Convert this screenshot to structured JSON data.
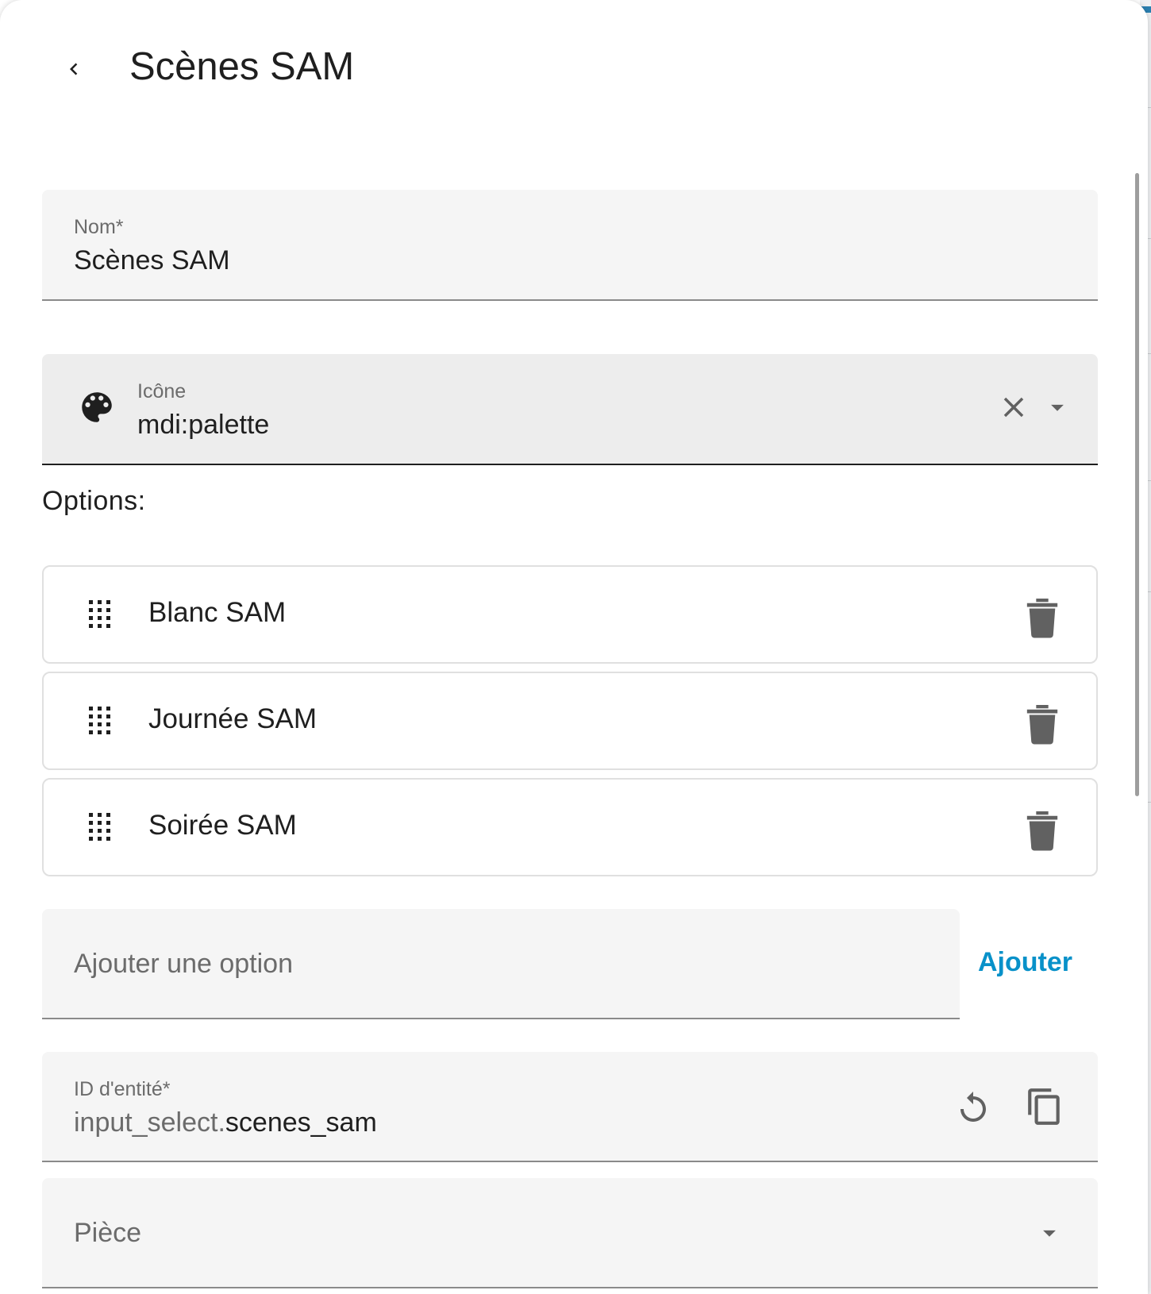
{
  "header": {
    "title": "Scènes SAM"
  },
  "form": {
    "name": {
      "label": "Nom*",
      "value": "Scènes SAM"
    },
    "icon": {
      "label": "Icône",
      "value": "mdi:palette",
      "icon_name": "palette-icon"
    },
    "options_label": "Options:",
    "options": [
      {
        "label": "Blanc SAM"
      },
      {
        "label": "Journée SAM"
      },
      {
        "label": "Soirée SAM"
      }
    ],
    "add_option": {
      "placeholder": "Ajouter une option",
      "button_label": "Ajouter"
    },
    "entity_id": {
      "label": "ID d'entité*",
      "prefix": "input_select.",
      "value": "scenes_sam"
    },
    "area": {
      "placeholder": "Pièce"
    }
  },
  "colors": {
    "accent": "#0891c9",
    "field_background": "#f5f5f5",
    "icon_gray": "#616161"
  }
}
